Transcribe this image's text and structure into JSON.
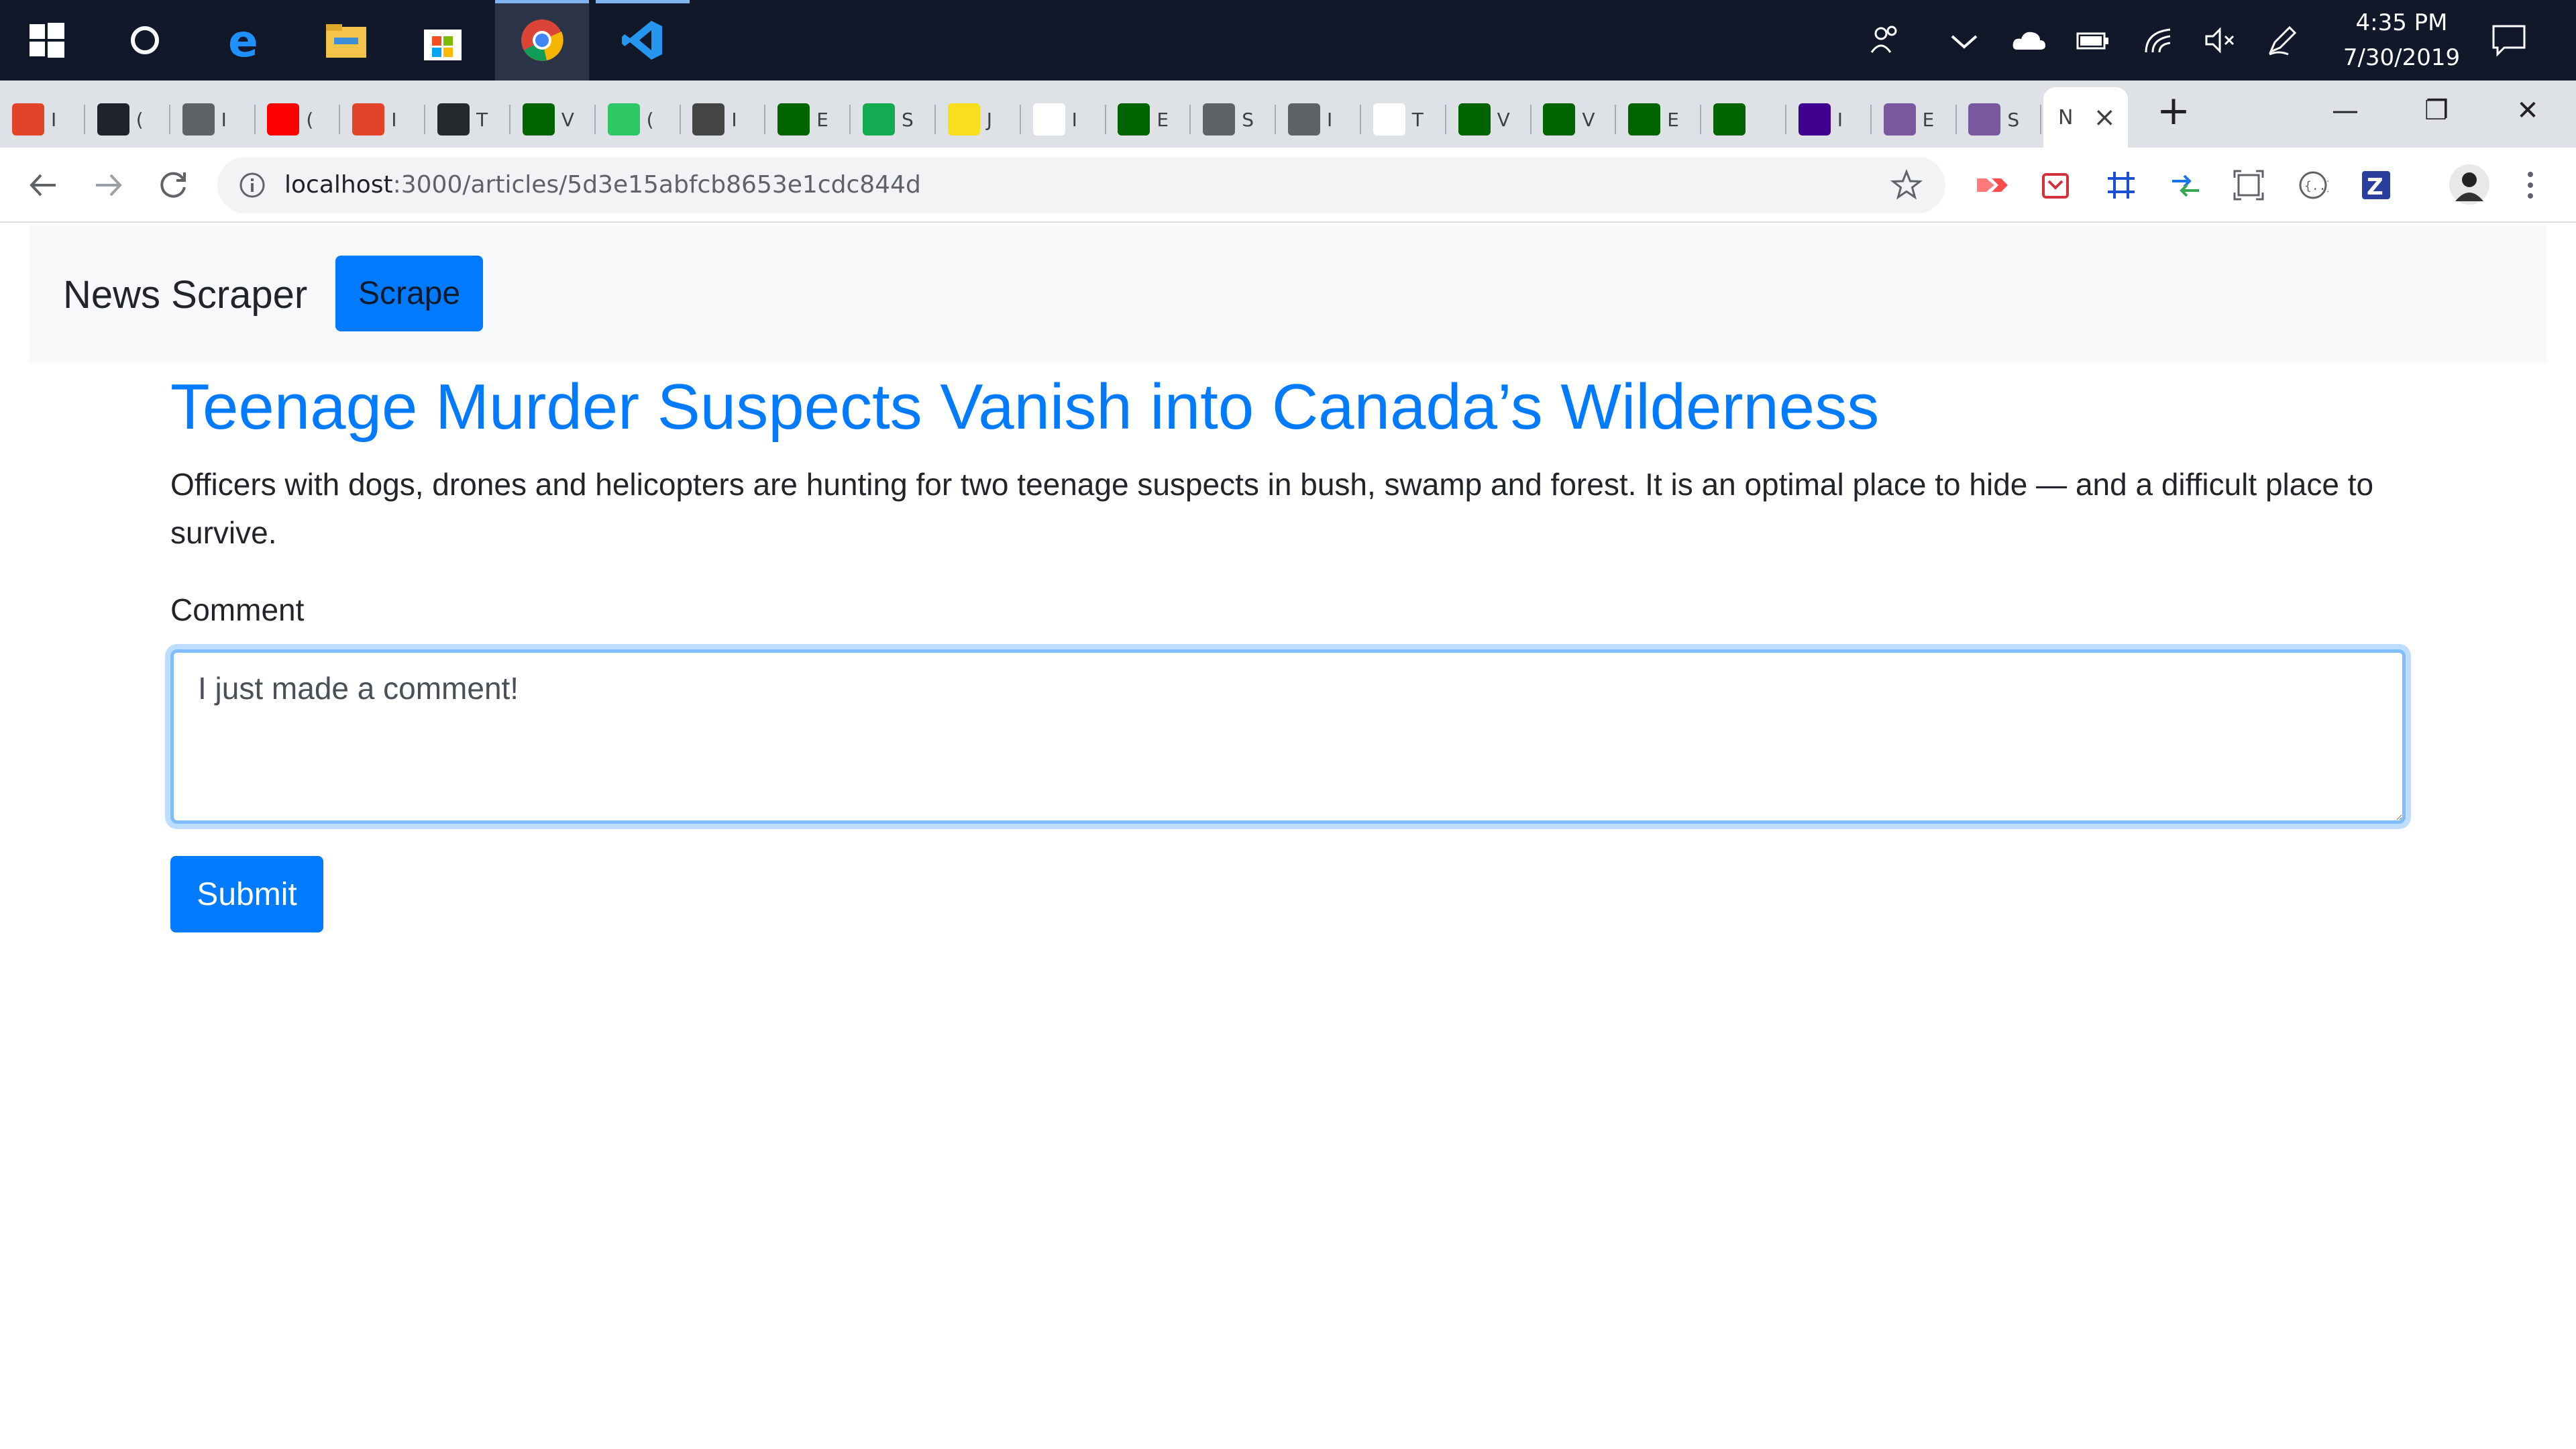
{
  "taskbar": {
    "apps": [
      "windows-start",
      "cortana",
      "edge",
      "file-explorer",
      "microsoft-store",
      "chrome",
      "vscode"
    ],
    "tray_icons": [
      "people-icon",
      "chevron-up-icon",
      "onedrive-icon",
      "battery-icon",
      "wifi-icon",
      "volume-muted-icon",
      "pen-icon",
      "notification-icon"
    ],
    "time": "4:35 PM",
    "date": "7/30/2019"
  },
  "browser": {
    "tabs": [
      {
        "icon": "gitlab-icon",
        "frag": "I",
        "color": "#e24329"
      },
      {
        "icon": "react-icon",
        "frag": "(",
        "color": "#20232a"
      },
      {
        "icon": "globe-icon",
        "frag": "I",
        "color": "#5f6368"
      },
      {
        "icon": "youtube-icon",
        "frag": "(",
        "color": "#ff0000"
      },
      {
        "icon": "gitlab-icon",
        "frag": "I",
        "color": "#e24329"
      },
      {
        "icon": "github-icon",
        "frag": "T",
        "color": "#24292e"
      },
      {
        "icon": "freecodecamp-icon",
        "frag": "V",
        "color": "#006400"
      },
      {
        "icon": "hackerrank-icon",
        "frag": "(",
        "color": "#2ec866"
      },
      {
        "icon": "book-icon",
        "frag": "I",
        "color": "#444444"
      },
      {
        "icon": "freecodecamp-icon",
        "frag": "E",
        "color": "#006400"
      },
      {
        "icon": "mongodb-icon",
        "frag": "S",
        "color": "#13aa52"
      },
      {
        "icon": "javascript-icon",
        "frag": "J",
        "color": "#f7df1e"
      },
      {
        "icon": "medium-icon",
        "frag": "I",
        "color": "#ffffff"
      },
      {
        "icon": "freecodecamp-icon",
        "frag": "E",
        "color": "#006400"
      },
      {
        "icon": "globe-icon",
        "frag": "S",
        "color": "#5f6368"
      },
      {
        "icon": "globe-icon",
        "frag": "I",
        "color": "#5f6368"
      },
      {
        "icon": "amazon-icon",
        "frag": "T",
        "color": "#ffffff"
      },
      {
        "icon": "freecodecamp-icon",
        "frag": "V",
        "color": "#006400"
      },
      {
        "icon": "freecodecamp-icon",
        "frag": "V",
        "color": "#006400"
      },
      {
        "icon": "freecodecamp-icon",
        "frag": "E",
        "color": "#006400"
      },
      {
        "icon": "freecodecamp-icon",
        "frag": "",
        "color": "#006400"
      },
      {
        "icon": "yahoo-icon",
        "frag": "I",
        "color": "#400090"
      },
      {
        "icon": "heroku-icon",
        "frag": "E",
        "color": "#79589f"
      },
      {
        "icon": "heroku-icon",
        "frag": "S",
        "color": "#79589f"
      }
    ],
    "active_tab": {
      "frag": "N",
      "close": "×"
    },
    "new_tab": "+",
    "window_controls": {
      "minimize": "—",
      "restore": "❐",
      "close": "✕"
    },
    "url_host": "localhost",
    "url_rest": ":3000/articles/5d3e15abfcb8653e1cdc844d"
  },
  "page": {
    "brand": "News Scraper",
    "scrape_label": "Scrape",
    "article": {
      "title": "Teenage Murder Suspects Vanish into Canada’s Wilderness",
      "summary": "Officers with dogs, drones and helicopters are hunting for two teenage suspects in bush, swamp and forest. It is an optimal place to hide — and a difficult place to survive."
    },
    "comment_label": "Comment",
    "comment_value": "I just made a comment!",
    "submit_label": "Submit"
  }
}
